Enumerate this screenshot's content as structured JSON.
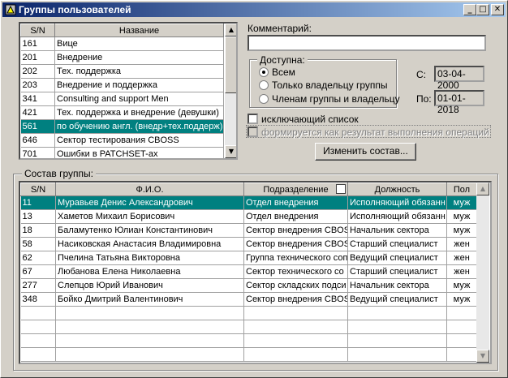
{
  "window": {
    "title": "Группы пользователей",
    "min_glyph": "_",
    "max_glyph": "□",
    "close_glyph": "✕"
  },
  "groups_table": {
    "columns": [
      "S/N",
      "Название"
    ],
    "rows": [
      {
        "sn": "161",
        "name": "Вице"
      },
      {
        "sn": "201",
        "name": "Внедрение"
      },
      {
        "sn": "202",
        "name": "Тех. поддержка"
      },
      {
        "sn": "203",
        "name": "Внедрение и поддержка"
      },
      {
        "sn": "341",
        "name": "Consulting and support Men"
      },
      {
        "sn": "421",
        "name": "Тех. поддержка и внедрение (девушки)"
      },
      {
        "sn": "561",
        "name": "по обучению англ. (внедр+тех.поддерж)"
      },
      {
        "sn": "646",
        "name": "Сектор тестирования CBOSS"
      },
      {
        "sn": "701",
        "name": "Ошибки в PATCHSET-ах"
      }
    ],
    "selected_index": 6
  },
  "comment": {
    "label": "Комментарий:",
    "value": ""
  },
  "access": {
    "legend": "Доступна:",
    "options": [
      "Всем",
      "Только владельцу группы",
      "Членам группы и владельцу"
    ],
    "selected": 0
  },
  "dates": {
    "from_label": "С:",
    "from_value": "03-04-2000",
    "to_label": "По:",
    "to_value": "01-01-2018"
  },
  "exclusive_label": "исключающий список",
  "computed_label": "формируется как результат выполнения операций",
  "change_button": "Изменить состав...",
  "members": {
    "legend": "Состав группы:",
    "columns": [
      "S/N",
      "Ф.И.О.",
      "Подразделение",
      "Должность",
      "Пол"
    ],
    "rows": [
      {
        "sn": "11",
        "name": "Муравьев Денис Александрович",
        "dept": "Отдел внедрения",
        "pos": "Исполняющий обязанн",
        "sex": "муж"
      },
      {
        "sn": "13",
        "name": "Хаметов Михаил Борисович",
        "dept": "Отдел внедрения",
        "pos": "Исполняющий обязанн",
        "sex": "муж"
      },
      {
        "sn": "18",
        "name": "Баламутенко Юлиан Константинович",
        "dept": "Сектор внедрения CBOS",
        "pos": "Начальник сектора",
        "sex": "муж"
      },
      {
        "sn": "58",
        "name": "Насиковская Анастасия Владимировна",
        "dept": "Сектор внедрения CBOS",
        "pos": "Старший специалист",
        "sex": "жен"
      },
      {
        "sn": "62",
        "name": "Пчелина Татьяна Викторовна",
        "dept": "Группа технического соп",
        "pos": "Ведущий специалист",
        "sex": "жен"
      },
      {
        "sn": "67",
        "name": "Любанова Елена Николаевна",
        "dept": "Сектор технического со",
        "pos": "Старший специалист",
        "sex": "жен"
      },
      {
        "sn": "277",
        "name": "Слепцов Юрий Иванович",
        "dept": "Сектор складских подси",
        "pos": "Начальник сектора",
        "sex": "муж"
      },
      {
        "sn": "348",
        "name": "Бойко Дмитрий Валентинович",
        "dept": "Сектор внедрения CBOS",
        "pos": "Ведущий специалист",
        "sex": "муж"
      }
    ],
    "selected_index": 0,
    "empty_rows": 4
  }
}
